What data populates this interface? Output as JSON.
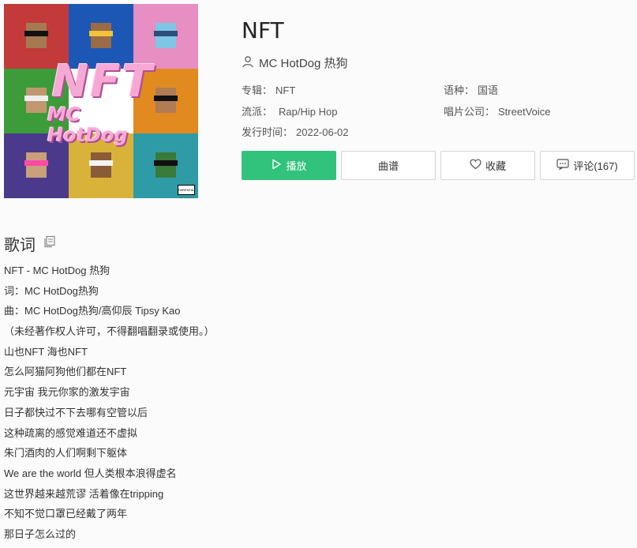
{
  "song": {
    "title": "NFT",
    "artist": "MC HotDog 热狗"
  },
  "album_cover": {
    "overlay_title": "NFT",
    "overlay_subtitle": "MC HotDog",
    "advisory_label": "PARENTAL ADVISORY"
  },
  "meta": {
    "album_label": "专辑：",
    "album_value": "NFT",
    "language_label": "语种：",
    "language_value": "国语",
    "genre_label": "流派：",
    "genre_value": "Rap/Hip Hop",
    "company_label": "唱片公司：",
    "company_value": "StreetVoice",
    "release_label": "发行时间：",
    "release_value": "2022-06-02"
  },
  "actions": {
    "play": "播放",
    "score": "曲谱",
    "favorite": "收藏",
    "comments": "评论(167)"
  },
  "lyrics": {
    "heading": "歌词",
    "lines": [
      "NFT - MC HotDog 热狗",
      "词：MC HotDog热狗",
      "曲：MC HotDog热狗/高仰辰 Tipsy Kao",
      "（未经著作权人许可，不得翻唱翻录或使用。）",
      "山也NFT 海也NFT",
      "怎么阿猫阿狗他们都在NFT",
      "元宇宙 我元你家的激发宇宙",
      "日子都快过不下去哪有空管以后",
      "这种疏离的感觉难道还不虚拟",
      "朱门酒肉的人们啊剩下躯体",
      "We are the world 但人类根本浪得虚名",
      "这世界越来越荒谬 活着像在tripping",
      "不知不觉口罩已经戴了两年",
      "那日子怎么过的"
    ]
  },
  "colors": {
    "accent": "#31c27c",
    "cover_tiles": [
      "#c23a3a",
      "#1d57b5",
      "#e78ec2",
      "#3d9c3a",
      "#ffffff",
      "#e08a1f",
      "#4b3a8c",
      "#d9b23a",
      "#2f9ba7"
    ]
  },
  "icons": {
    "artist": "user-icon",
    "play": "play-icon",
    "favorite": "heart-icon",
    "comments": "comment-icon",
    "copy": "copy-icon"
  }
}
